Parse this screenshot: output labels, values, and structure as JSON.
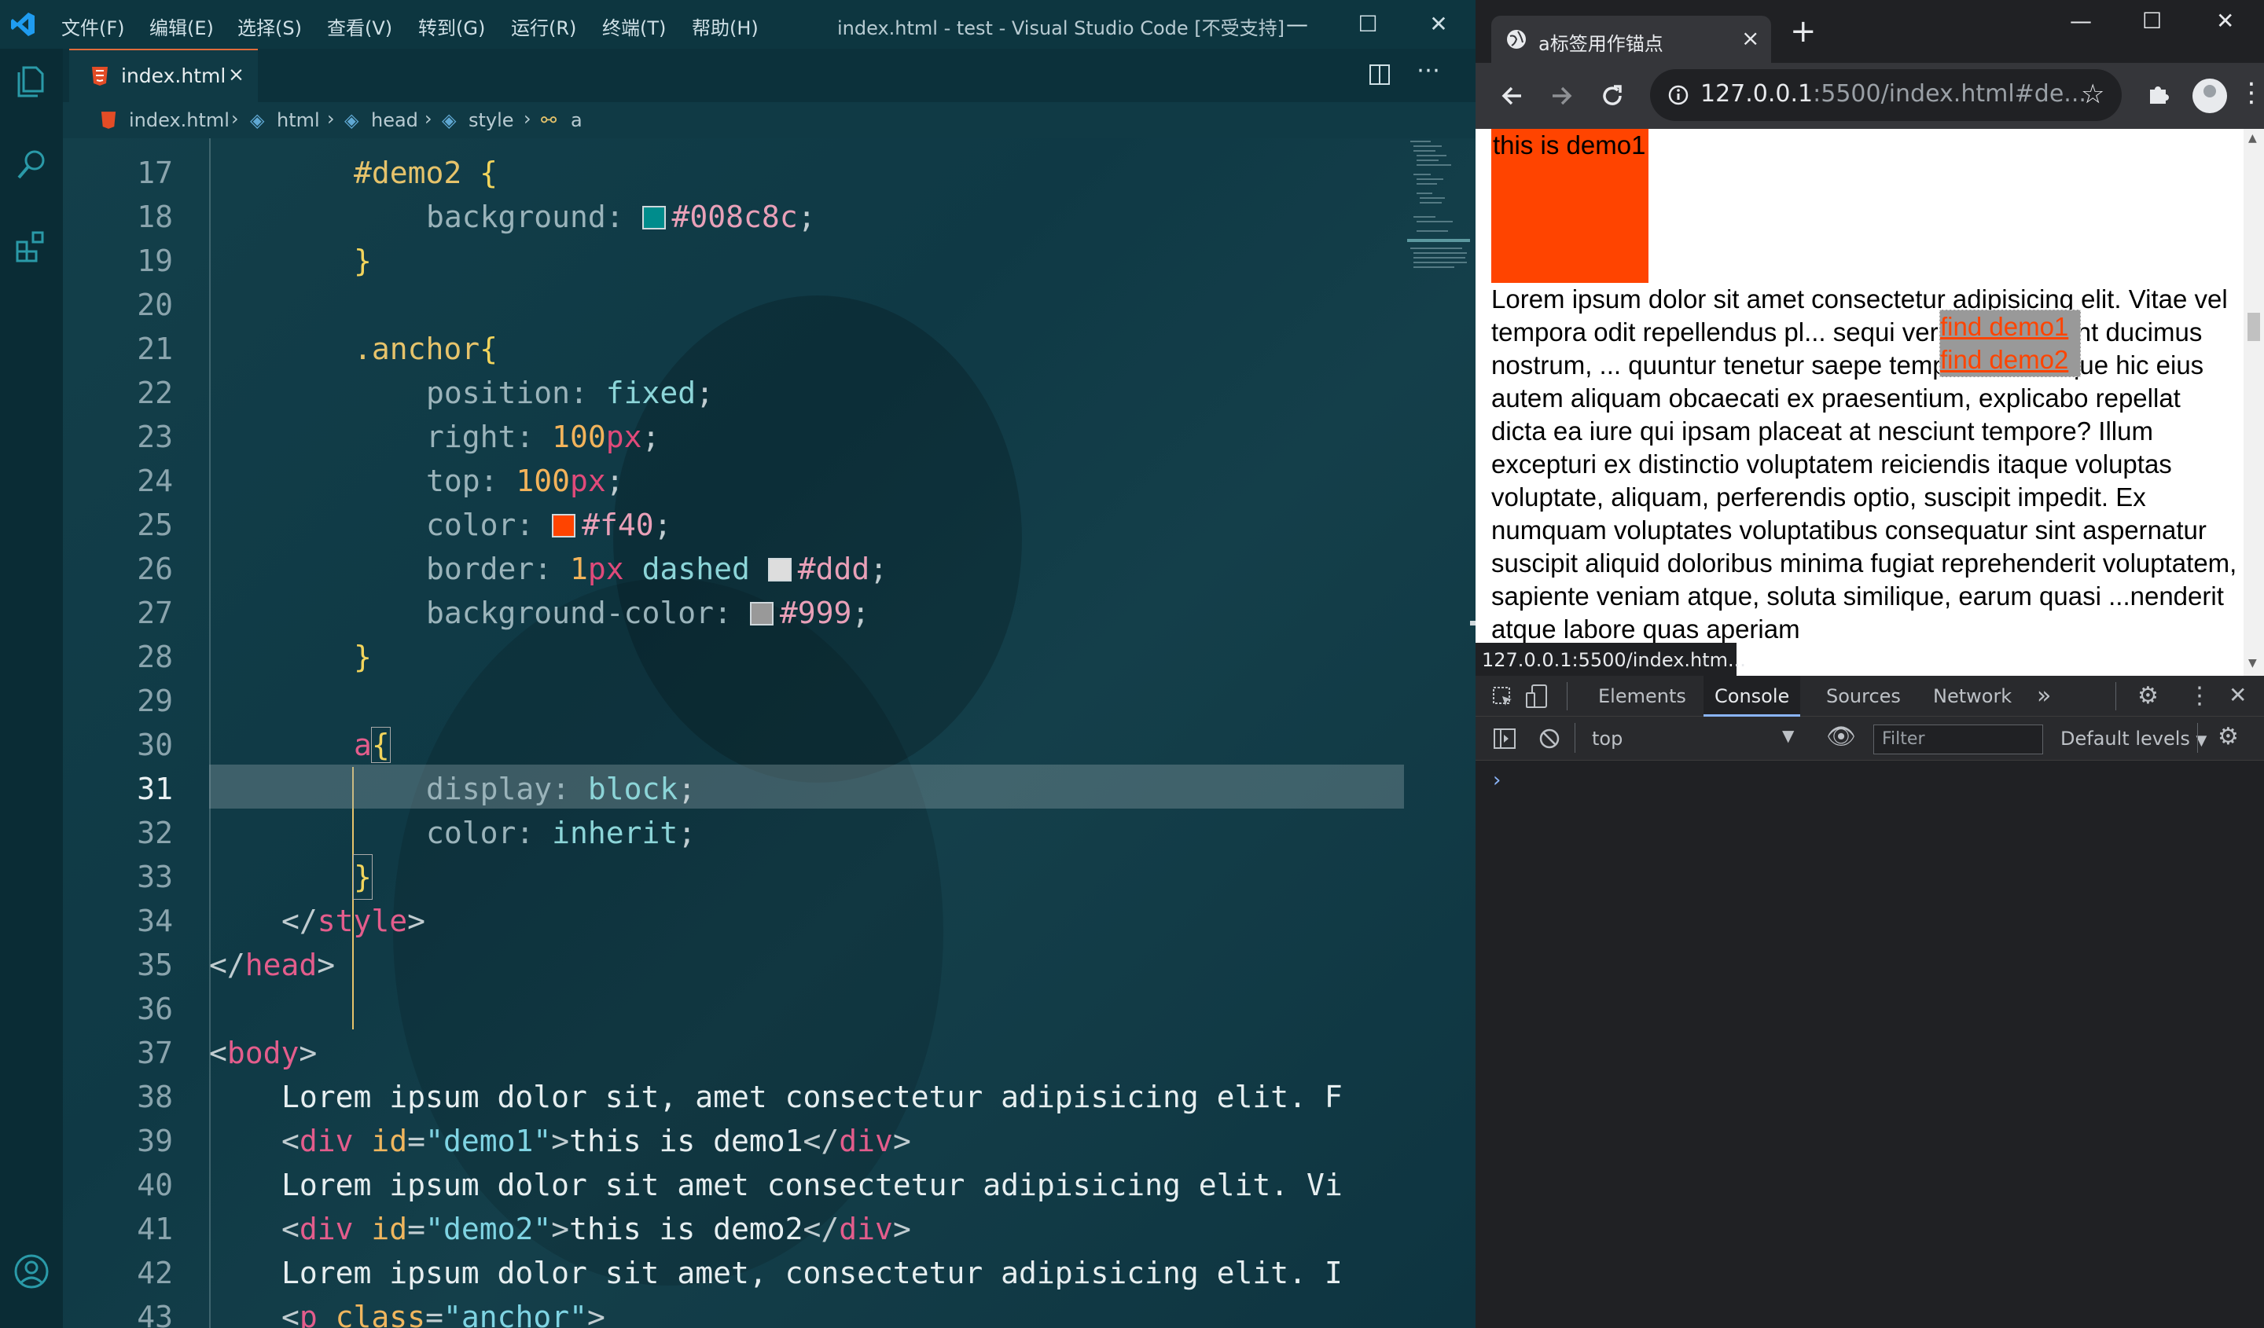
{
  "vscode": {
    "window_title": "index.html - test - Visual Studio Code [不受支持]",
    "menu": [
      "文件(F)",
      "编辑(E)",
      "选择(S)",
      "查看(V)",
      "转到(G)",
      "运行(R)",
      "终端(T)",
      "帮助(H)"
    ],
    "tab": {
      "label": "index.html",
      "close": "×"
    },
    "breadcrumb": {
      "file": "index.html",
      "html": "html",
      "head": "head",
      "style": "style",
      "a": "a"
    },
    "line_numbers": [
      "17",
      "18",
      "19",
      "20",
      "21",
      "22",
      "23",
      "24",
      "25",
      "26",
      "27",
      "28",
      "29",
      "30",
      "31",
      "32",
      "33",
      "34",
      "35",
      "36",
      "37",
      "38",
      "39",
      "40",
      "41",
      "42",
      "43"
    ],
    "current_line": "31",
    "code": {
      "l17_sel": "#demo2",
      "l17_brace": " {",
      "l18_prop": "background: ",
      "l18_hex": "#008c8c",
      "l18_semi": ";",
      "l19": "}",
      "l21_sel": ".anchor",
      "l21_brace": "{",
      "l22_prop": "position: ",
      "l22_val": "fixed",
      "l22_semi": ";",
      "l23_prop": "right: ",
      "l23_num": "100",
      "l23_unit": "px",
      "l23_semi": ";",
      "l24_prop": "top: ",
      "l24_num": "100",
      "l24_unit": "px",
      "l24_semi": ";",
      "l25_prop": "color: ",
      "l25_hex": "#f40",
      "l25_semi": ";",
      "l26_prop": "border: ",
      "l26_num": "1",
      "l26_unit": "px",
      "l26_val": " dashed ",
      "l26_hex": "#ddd",
      "l26_semi": ";",
      "l27_prop": "background-color: ",
      "l27_hex": "#999",
      "l27_semi": ";",
      "l28": "}",
      "l30_sel": "a",
      "l30_brace": "{",
      "l31_prop": "display: ",
      "l31_val": "block",
      "l31_semi": ";",
      "l32_prop": "color: ",
      "l32_val": "inherit",
      "l32_semi": ";",
      "l33": "}",
      "l34_open": "</",
      "l34_tag": "style",
      "l34_close": ">",
      "l35_open": "</",
      "l35_tag": "head",
      "l35_close": ">",
      "l37_open": "<",
      "l37_tag": "body",
      "l37_close": ">",
      "l38_txt": "Lorem ipsum dolor sit, amet consectetur adipisicing elit. F",
      "l39_open": "<",
      "l39_tag": "div",
      "l39_attr": " id",
      "l39_eq": "=",
      "l39_str": "\"demo1\"",
      "l39_gt": ">",
      "l39_txt": "this is demo1",
      "l39_end_open": "</",
      "l39_end_tag": "div",
      "l39_end_close": ">",
      "l40_txt": "Lorem ipsum dolor sit amet consectetur adipisicing elit. Vi",
      "l41_open": "<",
      "l41_tag": "div",
      "l41_attr": " id",
      "l41_eq": "=",
      "l41_str": "\"demo2\"",
      "l41_gt": ">",
      "l41_txt": "this is demo2",
      "l41_end_open": "</",
      "l41_end_tag": "div",
      "l41_end_close": ">",
      "l42_txt": "Lorem ipsum dolor sit amet, consectetur adipisicing elit. I",
      "l43_open": "<",
      "l43_tag": "p",
      "l43_attr": " class",
      "l43_eq": "=",
      "l43_str": "\"anchor\"",
      "l43_gt": ">"
    },
    "colors": {
      "swatch_1": "#008c8c",
      "swatch_2": "#ff4400",
      "swatch_3": "#dddddd",
      "swatch_4": "#999999"
    }
  },
  "chrome": {
    "tab_title": "a标签用作锚点",
    "tab_close": "×",
    "new_tab": "+",
    "url_host": "127.0.0.1",
    "url_rest": ":5500/index.html#de...",
    "page": {
      "demo1_text": "this is demo1",
      "lorem": "Lorem ipsum dolor sit amet consectetur adipisicing elit. Vitae vel tempora odit repellendus pl... sequi veritatis non sunt ducimus nostrum, ... quuntur tenetur saepe temporibus. Neque hic eius autem aliquam obcaecati ex praesentium, explicabo repellat dicta ea iure qui ipsam placeat at nesciunt tempore? Illum excepturi ex distinctio voluptatem reiciendis itaque voluptas voluptate, aliquam, perferendis optio, suscipit impedit. Ex numquam voluptates voluptatibus consequatur sint aspernatur suscipit aliquid doloribus minima fugiat reprehenderit voluptatem, sapiente veniam atque, soluta similique, earum quasi ...nenderit atque labore quas aperiam",
      "link1": "find demo1",
      "link2": "find demo2"
    },
    "status_url": "127.0.0.1:5500/index.htm...",
    "devtools": {
      "tabs": [
        "Elements",
        "Console",
        "Sources",
        "Network"
      ],
      "active_tab": "Console",
      "more": "»",
      "context": "top",
      "filter_placeholder": "Filter",
      "levels": "Default levels",
      "prompt": "›"
    }
  }
}
